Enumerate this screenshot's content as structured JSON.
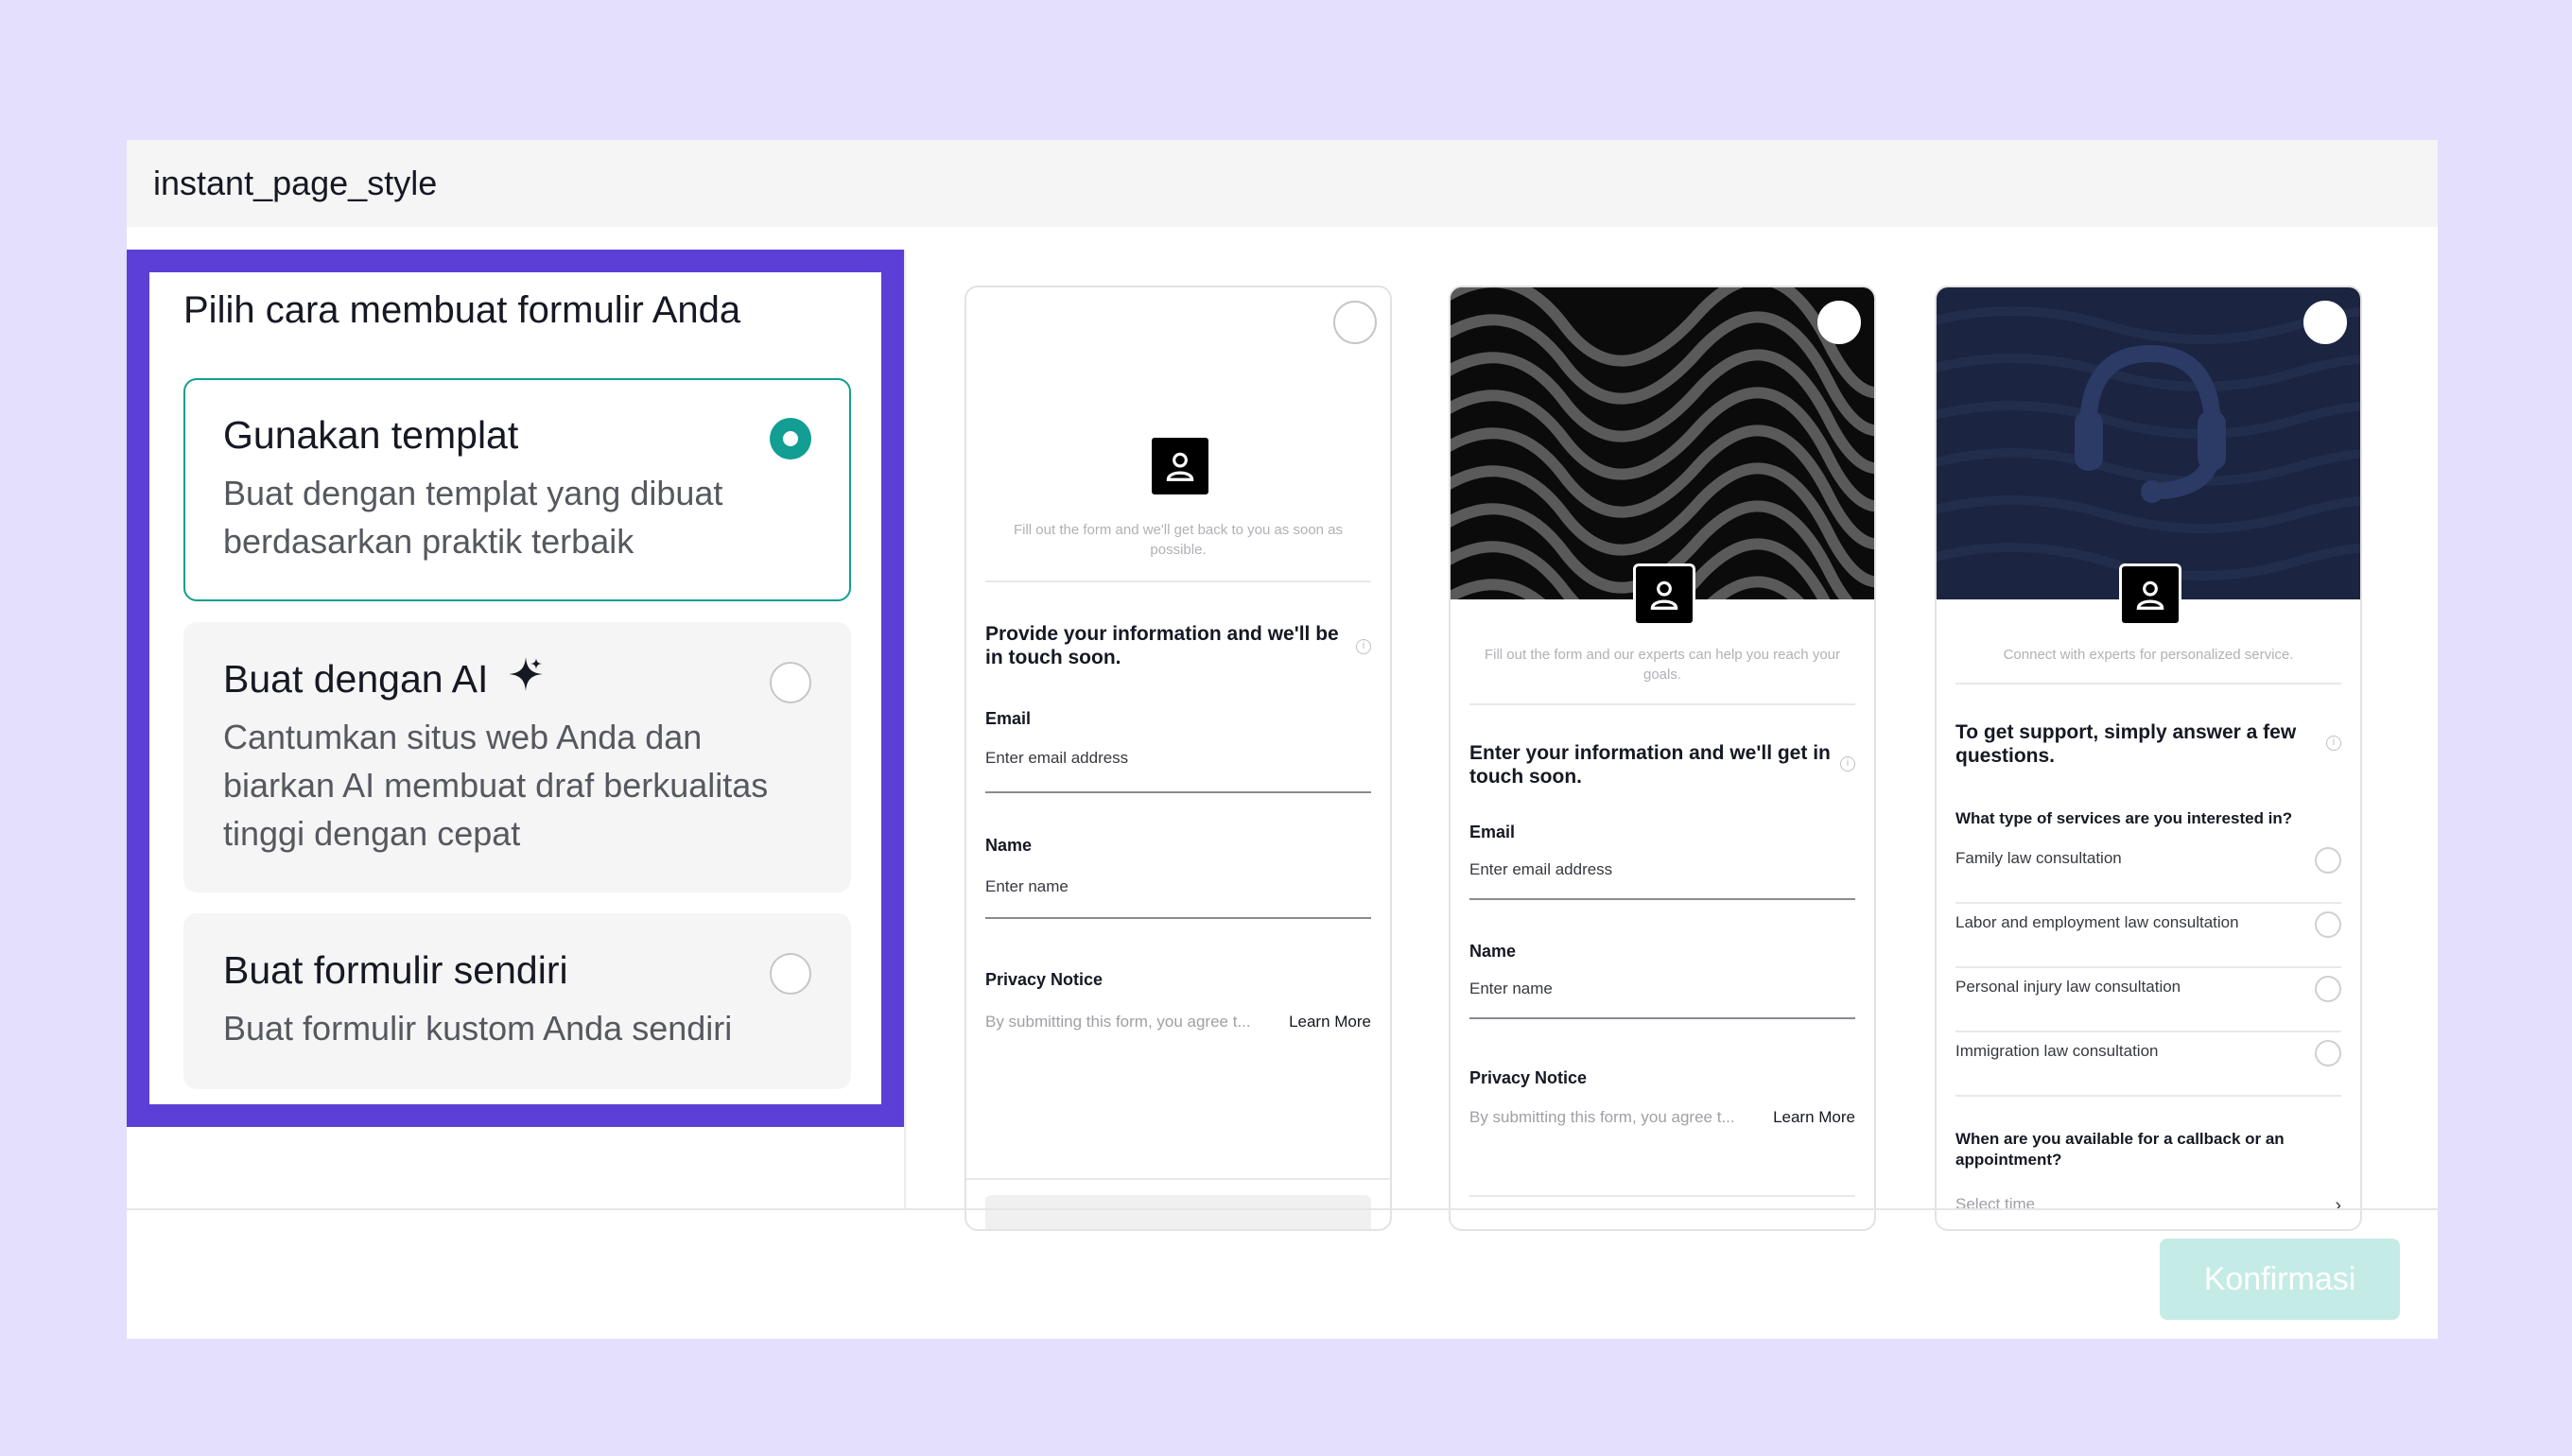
{
  "window": {
    "title": "instant_page_style"
  },
  "left": {
    "heading": "Pilih cara membuat formulir Anda",
    "options": [
      {
        "title": "Gunakan templat",
        "description": "Buat dengan templat yang dibuat berdasarkan praktik terbaik",
        "selected": true
      },
      {
        "title": "Buat dengan AI",
        "description": "Cantumkan situs web Anda dan biarkan AI membuat draf berkualitas tinggi dengan cepat",
        "selected": false,
        "icon": "sparkle-icon"
      },
      {
        "title": "Buat formulir sendiri",
        "description": "Buat formulir kustom Anda sendiri",
        "selected": false
      }
    ]
  },
  "templates": [
    {
      "subtitle": "Fill out the form and we'll get back to you as soon as possible.",
      "heading": "Provide your information and we'll be in touch soon.",
      "email_label": "Email",
      "email_placeholder": "Enter email address",
      "name_label": "Name",
      "name_placeholder": "Enter name",
      "privacy_label": "Privacy Notice",
      "privacy_text": "By submitting this form, you agree t...",
      "learn_more": "Learn More"
    },
    {
      "subtitle": "Fill out the form and our experts can help you reach your goals.",
      "heading": "Enter your information and we'll get in touch soon.",
      "email_label": "Email",
      "email_placeholder": "Enter email address",
      "name_label": "Name",
      "name_placeholder": "Enter name",
      "privacy_label": "Privacy Notice",
      "privacy_text": "By submitting this form, you agree t...",
      "learn_more": "Learn More"
    },
    {
      "subtitle": "Connect with experts for personalized service.",
      "heading": "To get support, simply answer a few questions.",
      "question1": "What type of services are you interested in?",
      "choices": [
        "Family law consultation",
        "Labor and employment law consultation",
        "Personal injury law consultation",
        "Immigration law consultation"
      ],
      "question2": "When are you available for a callback or an appointment?",
      "select_placeholder": "Select time"
    }
  ],
  "footer": {
    "confirm_label": "Konfirmasi"
  },
  "colors": {
    "accent": "#129e92",
    "highlight": "#5b3fd6",
    "background": "#e4dffd",
    "confirm_disabled": "#c5ebe6"
  }
}
